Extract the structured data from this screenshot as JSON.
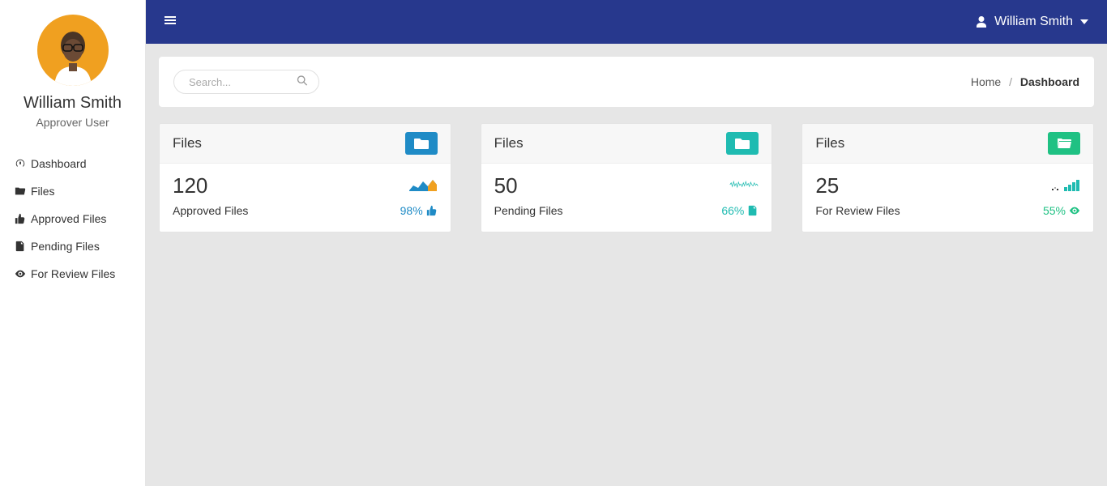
{
  "user": {
    "name": "William Smith",
    "role": "Approver User"
  },
  "nav": {
    "dashboard": "Dashboard",
    "files": "Files",
    "approved": "Approved Files",
    "pending": "Pending Files",
    "review": "For Review Files"
  },
  "topbar": {
    "user_name": "William Smith"
  },
  "search": {
    "placeholder": "Search..."
  },
  "breadcrumb": {
    "home": "Home",
    "current": "Dashboard"
  },
  "cards": {
    "approved": {
      "title": "Files",
      "count": "120",
      "subtitle": "Approved Files",
      "pct": "98%"
    },
    "pending": {
      "title": "Files",
      "count": "50",
      "subtitle": "Pending Files",
      "pct": "66%"
    },
    "review": {
      "title": "Files",
      "count": "25",
      "subtitle": "For Review Files",
      "pct": "55%"
    }
  },
  "colors": {
    "brand": "#27388d",
    "blue": "#1f8bc6",
    "teal": "#1fbbb1",
    "green": "#1fc183"
  }
}
